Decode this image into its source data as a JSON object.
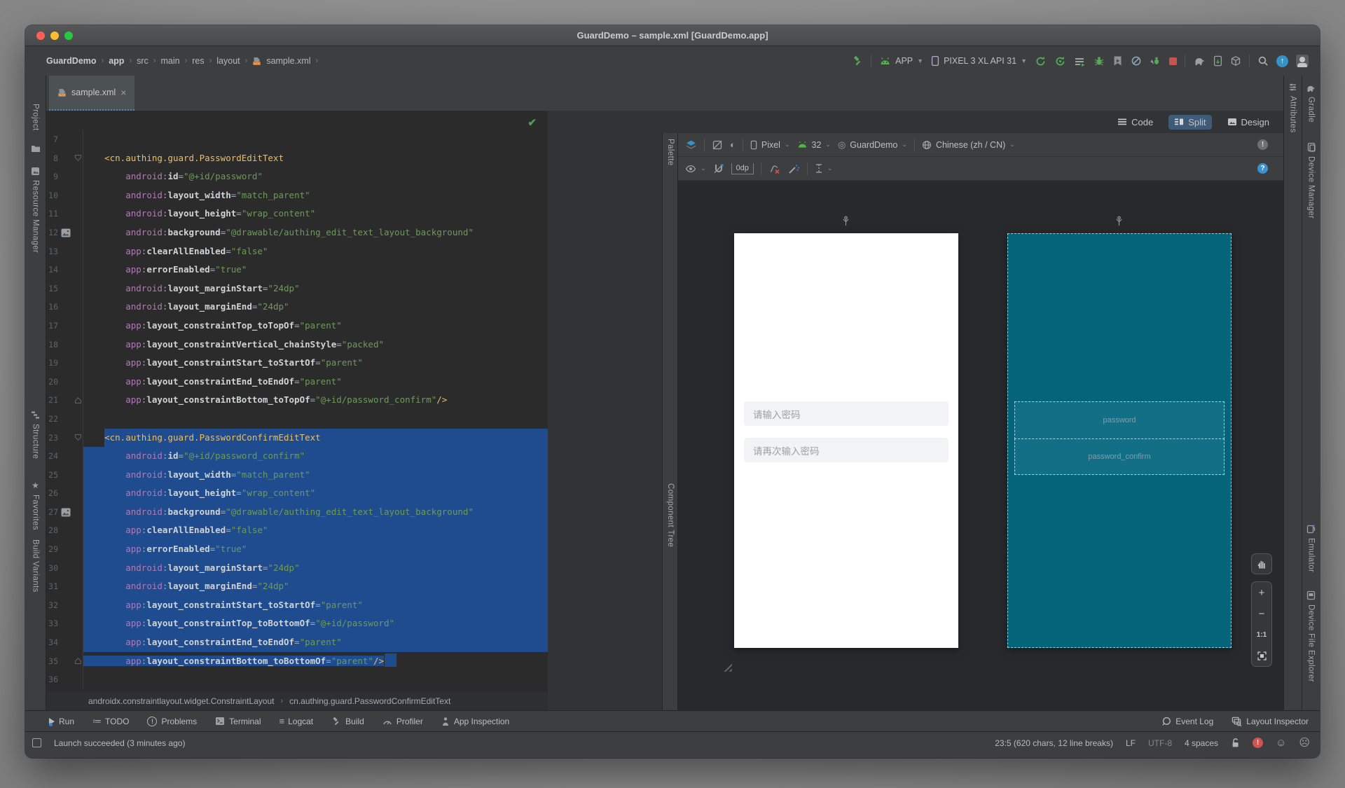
{
  "window": {
    "title": "GuardDemo – sample.xml [GuardDemo.app]"
  },
  "nav": {
    "separator": "›",
    "breadcrumbs": [
      {
        "label": "GuardDemo",
        "bold": true
      },
      {
        "label": "app",
        "bold": true
      },
      {
        "label": "src"
      },
      {
        "label": "main"
      },
      {
        "label": "res"
      },
      {
        "label": "layout"
      },
      {
        "label": "sample.xml",
        "icon": "xml-file-icon"
      }
    ],
    "run_config": "APP",
    "device": "PIXEL 3 XL API 31"
  },
  "tabs": {
    "active_tab": "sample.xml"
  },
  "left_strip": {
    "items": [
      "Project",
      "Resource Manager",
      "Structure",
      "Favorites",
      "Build Variants"
    ]
  },
  "right_strip": {
    "items": [
      "Gradle",
      "Device Manager",
      "Emulator",
      "Device File Explorer"
    ]
  },
  "editor": {
    "breadcrumb": [
      "androidx.constraintlayout.widget.ConstraintLayout",
      "cn.authing.guard.PasswordConfirmEditText"
    ],
    "lines": [
      {
        "n": 7,
        "seg": []
      },
      {
        "n": 8,
        "fold": "open",
        "seg": [
          [
            "p",
            "    "
          ],
          [
            "t",
            "<cn.authing.guard.PasswordEditText"
          ]
        ]
      },
      {
        "n": 9,
        "seg": [
          [
            "p",
            "        "
          ],
          [
            "n",
            "android"
          ],
          [
            "p",
            ":"
          ],
          [
            "a",
            "id"
          ],
          [
            "p",
            "="
          ],
          [
            "s",
            "\"@+id/password\""
          ]
        ]
      },
      {
        "n": 10,
        "seg": [
          [
            "p",
            "        "
          ],
          [
            "n",
            "android"
          ],
          [
            "p",
            ":"
          ],
          [
            "a",
            "layout_width"
          ],
          [
            "p",
            "="
          ],
          [
            "s",
            "\"match_parent\""
          ]
        ]
      },
      {
        "n": 11,
        "seg": [
          [
            "p",
            "        "
          ],
          [
            "n",
            "android"
          ],
          [
            "p",
            ":"
          ],
          [
            "a",
            "layout_height"
          ],
          [
            "p",
            "="
          ],
          [
            "s",
            "\"wrap_content\""
          ]
        ]
      },
      {
        "n": 12,
        "gicon": "image",
        "seg": [
          [
            "p",
            "        "
          ],
          [
            "n",
            "android"
          ],
          [
            "p",
            ":"
          ],
          [
            "a",
            "background"
          ],
          [
            "p",
            "="
          ],
          [
            "s",
            "\"@drawable/authing_edit_text_layout_background\""
          ]
        ]
      },
      {
        "n": 13,
        "seg": [
          [
            "p",
            "        "
          ],
          [
            "n",
            "app"
          ],
          [
            "p",
            ":"
          ],
          [
            "a",
            "clearAllEnabled"
          ],
          [
            "p",
            "="
          ],
          [
            "s",
            "\"false\""
          ]
        ]
      },
      {
        "n": 14,
        "seg": [
          [
            "p",
            "        "
          ],
          [
            "n",
            "app"
          ],
          [
            "p",
            ":"
          ],
          [
            "a",
            "errorEnabled"
          ],
          [
            "p",
            "="
          ],
          [
            "s",
            "\"true\""
          ]
        ]
      },
      {
        "n": 15,
        "seg": [
          [
            "p",
            "        "
          ],
          [
            "n",
            "android"
          ],
          [
            "p",
            ":"
          ],
          [
            "a",
            "layout_marginStart"
          ],
          [
            "p",
            "="
          ],
          [
            "s",
            "\"24dp\""
          ]
        ]
      },
      {
        "n": 16,
        "seg": [
          [
            "p",
            "        "
          ],
          [
            "n",
            "android"
          ],
          [
            "p",
            ":"
          ],
          [
            "a",
            "layout_marginEnd"
          ],
          [
            "p",
            "="
          ],
          [
            "s",
            "\"24dp\""
          ]
        ]
      },
      {
        "n": 17,
        "seg": [
          [
            "p",
            "        "
          ],
          [
            "n",
            "app"
          ],
          [
            "p",
            ":"
          ],
          [
            "a",
            "layout_constraintTop_toTopOf"
          ],
          [
            "p",
            "="
          ],
          [
            "s",
            "\"parent\""
          ]
        ]
      },
      {
        "n": 18,
        "seg": [
          [
            "p",
            "        "
          ],
          [
            "n",
            "app"
          ],
          [
            "p",
            ":"
          ],
          [
            "a",
            "layout_constraintVertical_chainStyle"
          ],
          [
            "p",
            "="
          ],
          [
            "s",
            "\"packed\""
          ]
        ]
      },
      {
        "n": 19,
        "seg": [
          [
            "p",
            "        "
          ],
          [
            "n",
            "app"
          ],
          [
            "p",
            ":"
          ],
          [
            "a",
            "layout_constraintStart_toStartOf"
          ],
          [
            "p",
            "="
          ],
          [
            "s",
            "\"parent\""
          ]
        ]
      },
      {
        "n": 20,
        "seg": [
          [
            "p",
            "        "
          ],
          [
            "n",
            "app"
          ],
          [
            "p",
            ":"
          ],
          [
            "a",
            "layout_constraintEnd_toEndOf"
          ],
          [
            "p",
            "="
          ],
          [
            "s",
            "\"parent\""
          ]
        ]
      },
      {
        "n": 21,
        "fold": "close",
        "seg": [
          [
            "p",
            "        "
          ],
          [
            "n",
            "app"
          ],
          [
            "p",
            ":"
          ],
          [
            "a",
            "layout_constraintBottom_toTopOf"
          ],
          [
            "p",
            "="
          ],
          [
            "s",
            "\"@+id/password_confirm\""
          ],
          [
            "t",
            "/>"
          ]
        ]
      },
      {
        "n": 22,
        "seg": []
      },
      {
        "n": 23,
        "fold": "open",
        "sel": "from",
        "seg": [
          [
            "p",
            "    "
          ],
          [
            "t",
            "<cn.authing.guard.PasswordConfirmEditText"
          ]
        ]
      },
      {
        "n": 24,
        "sel": "full",
        "seg": [
          [
            "p",
            "        "
          ],
          [
            "n",
            "android"
          ],
          [
            "p",
            ":"
          ],
          [
            "a",
            "id"
          ],
          [
            "p",
            "="
          ],
          [
            "s",
            "\"@+id/password_confirm\""
          ]
        ]
      },
      {
        "n": 25,
        "sel": "full",
        "seg": [
          [
            "p",
            "        "
          ],
          [
            "n",
            "android"
          ],
          [
            "p",
            ":"
          ],
          [
            "a",
            "layout_width"
          ],
          [
            "p",
            "="
          ],
          [
            "s",
            "\"match_parent\""
          ]
        ]
      },
      {
        "n": 26,
        "sel": "full",
        "seg": [
          [
            "p",
            "        "
          ],
          [
            "n",
            "android"
          ],
          [
            "p",
            ":"
          ],
          [
            "a",
            "layout_height"
          ],
          [
            "p",
            "="
          ],
          [
            "s",
            "\"wrap_content\""
          ]
        ]
      },
      {
        "n": 27,
        "gicon": "image",
        "sel": "full",
        "seg": [
          [
            "p",
            "        "
          ],
          [
            "n",
            "android"
          ],
          [
            "p",
            ":"
          ],
          [
            "a",
            "background"
          ],
          [
            "p",
            "="
          ],
          [
            "s",
            "\"@drawable/authing_edit_text_layout_background\""
          ]
        ]
      },
      {
        "n": 28,
        "sel": "full",
        "seg": [
          [
            "p",
            "        "
          ],
          [
            "n",
            "app"
          ],
          [
            "p",
            ":"
          ],
          [
            "a",
            "clearAllEnabled"
          ],
          [
            "p",
            "="
          ],
          [
            "s",
            "\"false\""
          ]
        ]
      },
      {
        "n": 29,
        "sel": "full",
        "seg": [
          [
            "p",
            "        "
          ],
          [
            "n",
            "app"
          ],
          [
            "p",
            ":"
          ],
          [
            "a",
            "errorEnabled"
          ],
          [
            "p",
            "="
          ],
          [
            "s",
            "\"true\""
          ]
        ]
      },
      {
        "n": 30,
        "sel": "full",
        "seg": [
          [
            "p",
            "        "
          ],
          [
            "n",
            "android"
          ],
          [
            "p",
            ":"
          ],
          [
            "a",
            "layout_marginStart"
          ],
          [
            "p",
            "="
          ],
          [
            "s",
            "\"24dp\""
          ]
        ]
      },
      {
        "n": 31,
        "sel": "full",
        "seg": [
          [
            "p",
            "        "
          ],
          [
            "n",
            "android"
          ],
          [
            "p",
            ":"
          ],
          [
            "a",
            "layout_marginEnd"
          ],
          [
            "p",
            "="
          ],
          [
            "s",
            "\"24dp\""
          ]
        ]
      },
      {
        "n": 32,
        "sel": "full",
        "seg": [
          [
            "p",
            "        "
          ],
          [
            "n",
            "app"
          ],
          [
            "p",
            ":"
          ],
          [
            "a",
            "layout_constraintStart_toStartOf"
          ],
          [
            "p",
            "="
          ],
          [
            "s",
            "\"parent\""
          ]
        ]
      },
      {
        "n": 33,
        "sel": "full",
        "seg": [
          [
            "p",
            "        "
          ],
          [
            "n",
            "app"
          ],
          [
            "p",
            ":"
          ],
          [
            "a",
            "layout_constraintTop_toBottomOf"
          ],
          [
            "p",
            "="
          ],
          [
            "s",
            "\"@+id/password\""
          ]
        ]
      },
      {
        "n": 34,
        "sel": "full",
        "seg": [
          [
            "p",
            "        "
          ],
          [
            "n",
            "app"
          ],
          [
            "p",
            ":"
          ],
          [
            "a",
            "layout_constraintEnd_toEndOf"
          ],
          [
            "p",
            "="
          ],
          [
            "s",
            "\"parent\""
          ]
        ]
      },
      {
        "n": 35,
        "fold": "close",
        "sel": "text",
        "caret": true,
        "seg": [
          [
            "p",
            "        "
          ],
          [
            "n",
            "app"
          ],
          [
            "p",
            ":"
          ],
          [
            "a",
            "layout_constraintBottom_toBottomOf"
          ],
          [
            "p",
            "="
          ],
          [
            "s",
            "\"parent\""
          ],
          [
            "t",
            "/>"
          ]
        ]
      },
      {
        "n": 36,
        "seg": []
      }
    ]
  },
  "design": {
    "modes": [
      "Code",
      "Split",
      "Design"
    ],
    "active_mode": "Split",
    "palette_label": "Palette",
    "component_tree_label": "Component Tree",
    "attributes_label": "Attributes",
    "toolbar": {
      "device": "Pixel",
      "api_level": "32",
      "theme": "GuardDemo",
      "locale": "Chinese (zh / CN)",
      "default_margin": "0dp"
    },
    "white_phone": {
      "fields": [
        "请输入密码",
        "请再次输入密码"
      ]
    },
    "blueprint": {
      "labels": [
        "password",
        "password_confirm"
      ]
    },
    "zoom_controls": {
      "scale": "1:1",
      "plus": "+",
      "minus": "−"
    }
  },
  "bottom_bar": {
    "left": [
      "Run",
      "TODO",
      "Problems",
      "Terminal",
      "Logcat",
      "Build",
      "Profiler",
      "App Inspection"
    ],
    "right": [
      "Event Log",
      "Layout Inspector"
    ]
  },
  "status_bar": {
    "message": "Launch succeeded (3 minutes ago)",
    "caret_info": "23:5 (620 chars, 12 line breaks)",
    "line_separator": "LF",
    "encoding": "UTF-8",
    "indent_style": "4 spaces"
  },
  "icons": {
    "theme_glyph": "◐",
    "project_theme_glyph": "◎",
    "caret_glyph": "⌄",
    "check_glyph": "✔",
    "happy_face": "☺",
    "sad_face": "☹",
    "close_glyph": "×"
  },
  "colors": {
    "selection": "#1e4c8f",
    "accent_blue": "#3592c4",
    "blueprint_bg": "#05647a",
    "tag": "#e8bf6a",
    "string": "#6f9a5c",
    "namespace": "#b07cb5"
  }
}
